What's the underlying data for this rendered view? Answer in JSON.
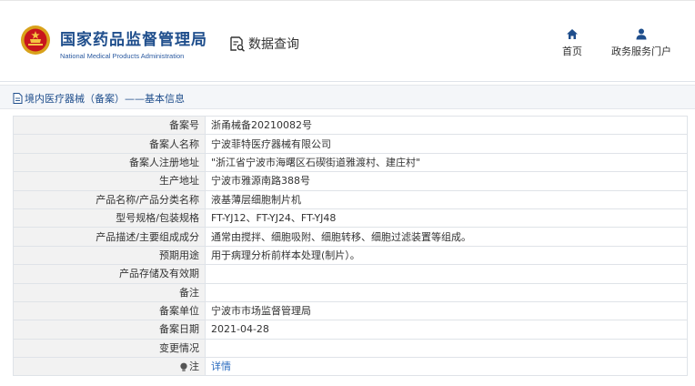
{
  "header": {
    "org_cn": "国家药品监督管理局",
    "org_en": "National Medical Products Administration",
    "search_label": "数据查询",
    "nav": [
      {
        "label": "首页",
        "icon": "home-icon"
      },
      {
        "label": "政务服务门户",
        "icon": "user-icon"
      }
    ]
  },
  "breadcrumb": {
    "text": "境内医疗器械（备案）——基本信息",
    "icon": "document-icon"
  },
  "details": {
    "rows": [
      {
        "key": "备案号",
        "value": "浙甬械备20210082号"
      },
      {
        "key": "备案人名称",
        "value": "宁波菲特医疗器械有限公司"
      },
      {
        "key": "备案人注册地址",
        "value": "\"浙江省宁波市海曙区石碶街道雅渡村、建庄村\""
      },
      {
        "key": "生产地址",
        "value": "宁波市雅源南路388号"
      },
      {
        "key": "产品名称/产品分类名称",
        "value": "液基薄层细胞制片机"
      },
      {
        "key": "型号规格/包装规格",
        "value": "FT-YJ12、FT-YJ24、FT-YJ48"
      },
      {
        "key": "产品描述/主要组成成分",
        "value": "通常由搅拌、细胞吸附、细胞转移、细胞过滤装置等组成。"
      },
      {
        "key": "预期用途",
        "value": "用于病理分析前样本处理(制片）。"
      },
      {
        "key": "产品存储及有效期",
        "value": ""
      },
      {
        "key": "备注",
        "value": ""
      },
      {
        "key": "备案单位",
        "value": "宁波市市场监督管理局"
      },
      {
        "key": "备案日期",
        "value": "2021-04-28"
      },
      {
        "key": "变更情况",
        "value": ""
      }
    ],
    "note_row": {
      "key": "注",
      "value": "详情",
      "icon": "info-bulb-icon"
    }
  },
  "colors": {
    "brand": "#1f4e8c",
    "link": "#2a6bbf",
    "key_bg": "#f2f2f2"
  }
}
